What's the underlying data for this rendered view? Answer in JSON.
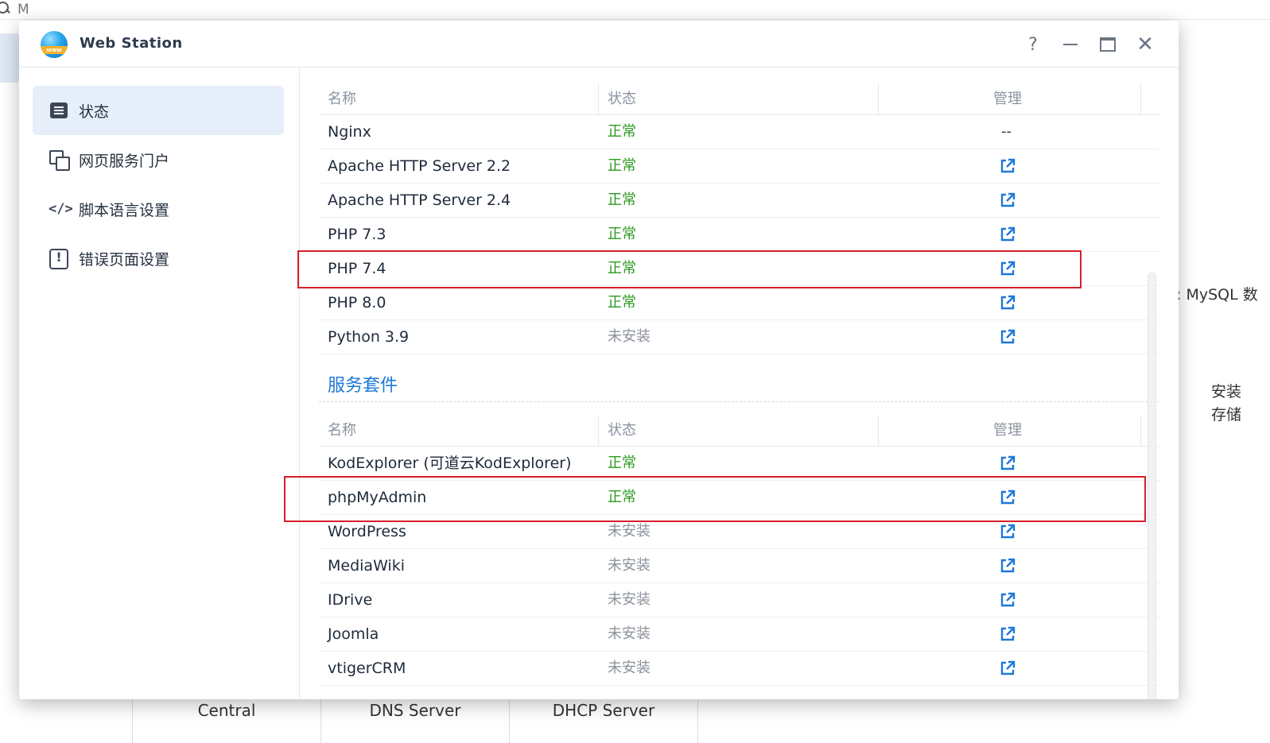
{
  "background": {
    "search_text": "M",
    "right_text_1": ": MySQL 数",
    "right_text_2": "安装",
    "right_text_3": "存储",
    "bottom_items": [
      "Central",
      "DNS Server",
      "DHCP Server"
    ]
  },
  "window": {
    "title": "Web Station",
    "controls": {
      "help": "?",
      "close": "✕"
    }
  },
  "sidebar": {
    "items": [
      {
        "label": "状态",
        "icon": "status-icon",
        "active": true
      },
      {
        "label": "网页服务门户",
        "icon": "portal-icon",
        "active": false
      },
      {
        "label": "脚本语言设置",
        "icon": "code-icon",
        "active": false
      },
      {
        "label": "错误页面设置",
        "icon": "error-page-icon",
        "active": false
      }
    ]
  },
  "services_table": {
    "columns": [
      "名称",
      "状态",
      "管理"
    ],
    "rows": [
      {
        "name": "Nginx",
        "status": "正常",
        "manage": "--"
      },
      {
        "name": "Apache HTTP Server 2.2",
        "status": "正常",
        "manage": "open"
      },
      {
        "name": "Apache HTTP Server 2.4",
        "status": "正常",
        "manage": "open"
      },
      {
        "name": "PHP 7.3",
        "status": "正常",
        "manage": "open"
      },
      {
        "name": "PHP 7.4",
        "status": "正常",
        "manage": "open"
      },
      {
        "name": "PHP 8.0",
        "status": "正常",
        "manage": "open"
      },
      {
        "name": "Python 3.9",
        "status": "未安装",
        "manage": "open"
      }
    ]
  },
  "packages_section": {
    "title": "服务套件",
    "columns": [
      "名称",
      "状态",
      "管理"
    ],
    "rows": [
      {
        "name": "KodExplorer (可道云KodExplorer)",
        "status": "正常",
        "manage": "open"
      },
      {
        "name": "phpMyAdmin",
        "status": "正常",
        "manage": "open"
      },
      {
        "name": "WordPress",
        "status": "未安装",
        "manage": "open"
      },
      {
        "name": "MediaWiki",
        "status": "未安装",
        "manage": "open"
      },
      {
        "name": "IDrive",
        "status": "未安装",
        "manage": "open"
      },
      {
        "name": "Joomla",
        "status": "未安装",
        "manage": "open"
      },
      {
        "name": "vtigerCRM",
        "status": "未安装",
        "manage": "open"
      }
    ]
  },
  "colors": {
    "status_ok": "#2b9a1f",
    "status_not_installed": "#8c929b",
    "accent": "#1e78d8",
    "highlight": "#d81f2a"
  }
}
